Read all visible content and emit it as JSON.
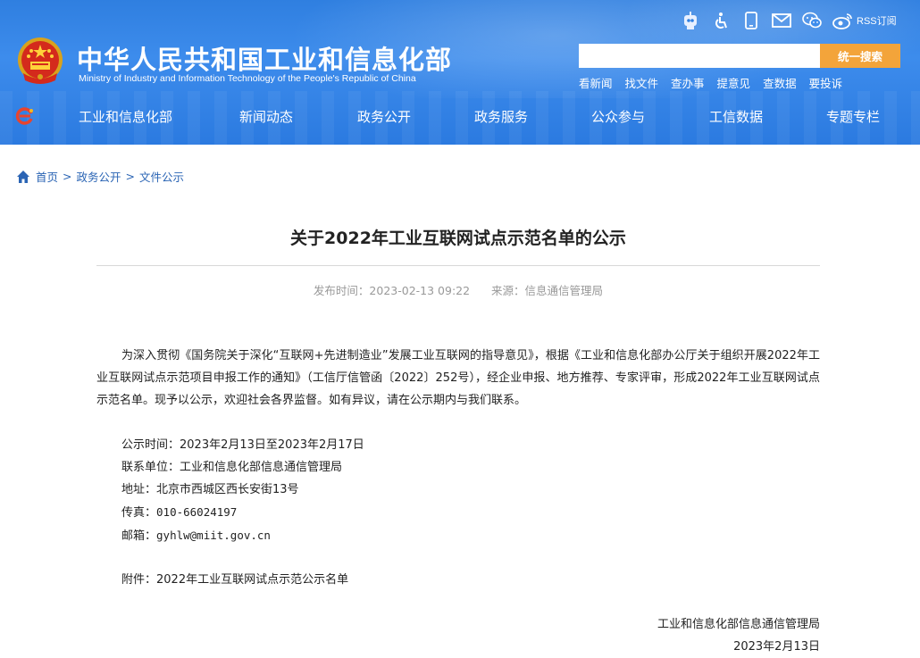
{
  "header": {
    "title_cn": "中华人民共和国工业和信息化部",
    "title_en": "Ministry of Industry and Information Technology of the People's Republic of China",
    "top_icons": [
      "robot-icon",
      "accessibility-icon",
      "mobile-icon",
      "mail-icon",
      "wechat-icon",
      "weibo-icon"
    ],
    "rss_label": "RSS订阅",
    "search_button": "统一搜索",
    "search_placeholder": "",
    "quick_links": [
      "看新闻",
      "找文件",
      "查办事",
      "提意见",
      "查数据",
      "要投诉"
    ],
    "nav": [
      "工业和信息化部",
      "新闻动态",
      "政务公开",
      "政务服务",
      "公众参与",
      "工信数据",
      "专题专栏"
    ]
  },
  "breadcrumb": [
    "首页",
    "政务公开",
    "文件公示"
  ],
  "breadcrumb_sep": ">",
  "article": {
    "title": "关于2022年工业互联网试点示范名单的公示",
    "publish_time": "发布时间：2023-02-13 09:22",
    "source": "来源：信息通信管理局",
    "paragraph": "为深入贯彻《国务院关于深化“互联网+先进制造业”发展工业互联网的指导意见》，根据《工业和信息化部办公厅关于组织开展2022年工业互联网试点示范项目申报工作的通知》（工信厅信管函〔2022〕252号），经企业申报、地方推荐、专家评审，形成2022年工业互联网试点示范名单。现予以公示，欢迎社会各界监督。如有异议，请在公示期内与我们联系。",
    "period": "公示时间：2023年2月13日至2023年2月17日",
    "contact_unit": "联系单位：工业和信息化部信息通信管理局",
    "address": "地址：北京市西城区西长安街13号",
    "fax_label": "传真：",
    "fax": "010-66024197",
    "email_label": "邮箱：",
    "email": "gyhlw@miit.gov.cn",
    "attachment": "附件：2022年工业互联网试点示范公示名单",
    "sign_org": "工业和信息化部信息通信管理局",
    "sign_date": "2023年2月13日"
  },
  "colors": {
    "header_blue": "#2f7fe0",
    "search_button": "#f3a43a",
    "link_blue": "#2a64b4"
  }
}
